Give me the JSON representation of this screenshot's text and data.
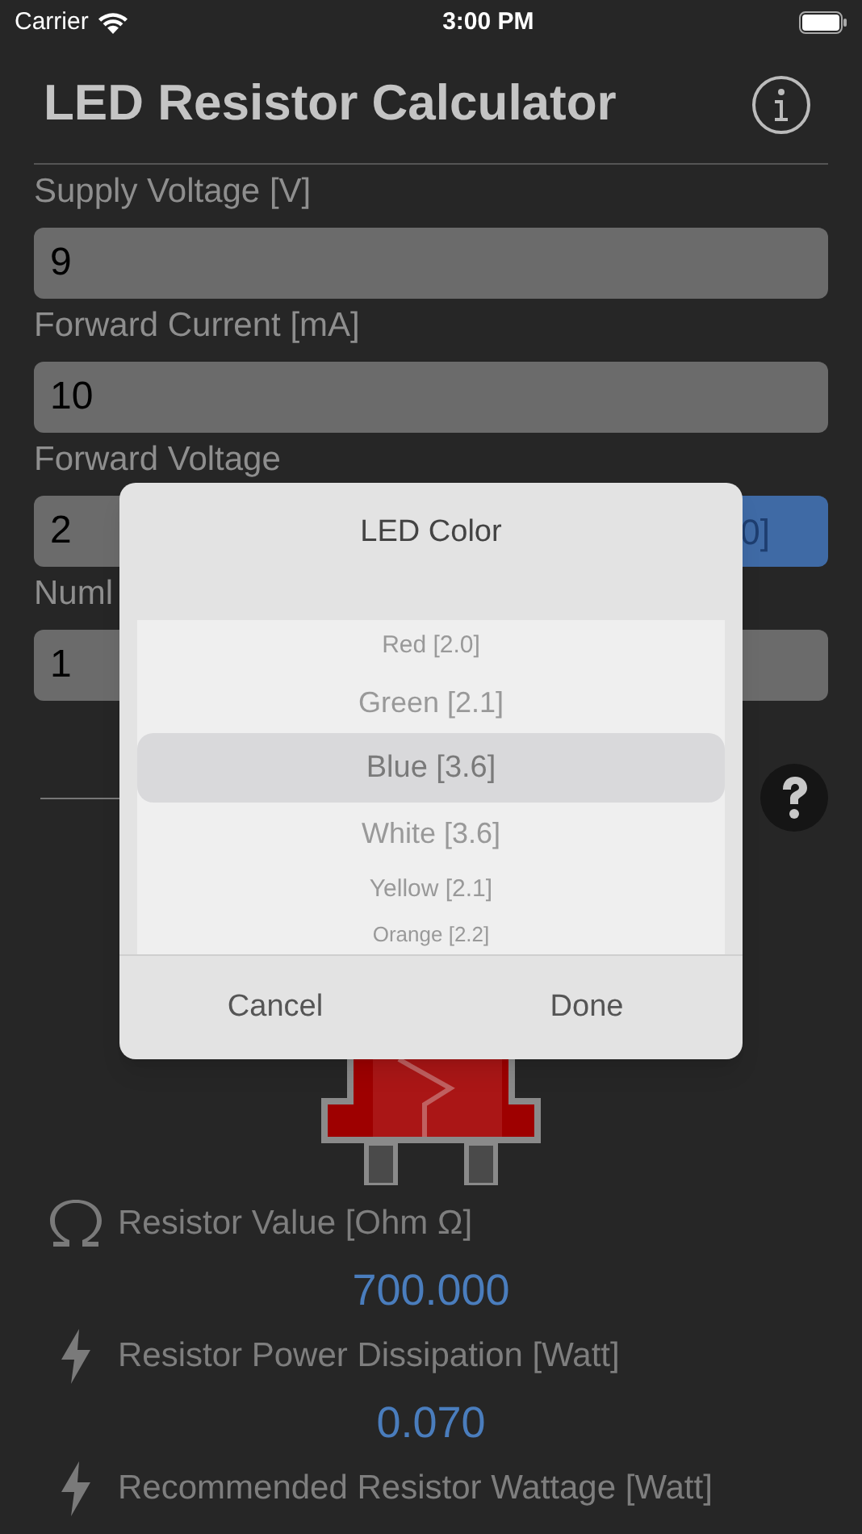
{
  "status_bar": {
    "carrier": "Carrier",
    "time": "3:00 PM"
  },
  "header": {
    "title": "LED Resistor Calculator"
  },
  "fields": [
    {
      "label": "Supply Voltage [V]",
      "value": "9"
    },
    {
      "label": "Forward Current [mA]",
      "value": "10"
    },
    {
      "label": "Forward Voltage",
      "value": "2",
      "button": "0]"
    },
    {
      "label": "Numl",
      "value": "1"
    }
  ],
  "results": [
    {
      "kind": "ohm",
      "label": "Resistor Value [Ohm Ω]",
      "value": "700.000"
    },
    {
      "kind": "bolt",
      "label": "Resistor Power Dissipation [Watt]",
      "value": "0.070"
    },
    {
      "kind": "bolt",
      "label": "Recommended Resistor Wattage [Watt]"
    }
  ],
  "dialog": {
    "title": "LED Color",
    "options": [
      {
        "label": "Red [2.0]",
        "selected": false
      },
      {
        "label": "Green [2.1]",
        "selected": false
      },
      {
        "label": "Blue [3.6]",
        "selected": true
      },
      {
        "label": "White [3.6]",
        "selected": false
      },
      {
        "label": "Yellow [2.1]",
        "selected": false
      },
      {
        "label": "Orange [2.2]",
        "selected": false
      }
    ],
    "buttons": [
      "Cancel",
      "Done"
    ]
  }
}
